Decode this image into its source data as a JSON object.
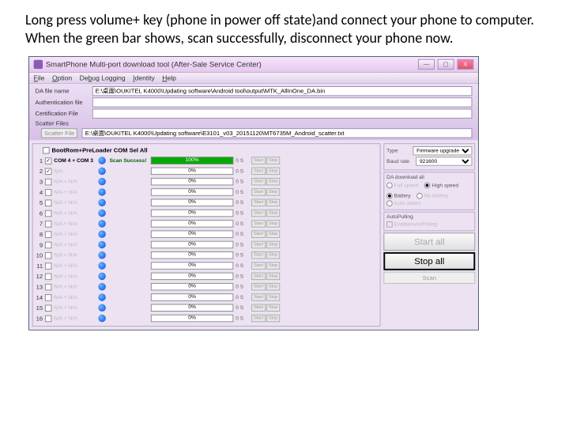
{
  "instruction": "Long press volume+ key (phone in power off state)and connect your phone to computer. When the green bar shows, scan successfully, disconnect your phone now.",
  "window": {
    "title": "SmartPhone Multi-port download tool (After-Sale Service Center)",
    "min": "—",
    "max": "▢",
    "close": "X"
  },
  "menu": [
    "File",
    "Option",
    "Debug Logging",
    "Identity",
    "Help"
  ],
  "files": {
    "da_label": "DA file name",
    "da_value": "E:\\桌面\\OUKITEL K4000\\Updating software\\Android tool\\output\\MTK_AllInOne_DA.bin",
    "auth_label": "Authentication file",
    "cert_label": "Certification File",
    "scatter_label": "Scatter Files",
    "scatter_btn": "Scatter File",
    "scatter_value": "E:\\桌面\\OUKITEL K4000\\Updating software\\E3101_v03_20151120\\MT6735M_Android_scatter.txt"
  },
  "selall_label": "BootRom+PreLoader COM Sel All",
  "rows": [
    {
      "idx": "1",
      "checked": true,
      "label": "COM 4 + COM 3",
      "active": true,
      "scan": "Scan Success!",
      "pct": "100%",
      "full": true,
      "size": "0 S"
    },
    {
      "idx": "2",
      "checked": true,
      "label": "N/A",
      "pct": "0%",
      "size": "0 S"
    },
    {
      "idx": "3",
      "label": "N/A + N/A",
      "pct": "0%",
      "size": "0 S"
    },
    {
      "idx": "4",
      "label": "N/A + N/A",
      "pct": "0%",
      "size": "0 S"
    },
    {
      "idx": "5",
      "label": "N/A + N/A",
      "pct": "0%",
      "size": "0 S"
    },
    {
      "idx": "6",
      "label": "N/A + N/A",
      "pct": "0%",
      "size": "0 S"
    },
    {
      "idx": "7",
      "label": "N/A + N/A",
      "pct": "0%",
      "size": "0 S"
    },
    {
      "idx": "8",
      "label": "N/A + N/A",
      "pct": "0%",
      "size": "0 S"
    },
    {
      "idx": "9",
      "label": "N/A + N/A",
      "pct": "0%",
      "size": "0 S"
    },
    {
      "idx": "10",
      "label": "N/A + N/A",
      "pct": "0%",
      "size": "0 S"
    },
    {
      "idx": "11",
      "label": "N/A + N/A",
      "pct": "0%",
      "size": "0 S"
    },
    {
      "idx": "12",
      "label": "N/A + N/A",
      "pct": "0%",
      "size": "0 S"
    },
    {
      "idx": "13",
      "label": "N/A + N/A",
      "pct": "0%",
      "size": "0 S"
    },
    {
      "idx": "14",
      "label": "N/A + N/A",
      "pct": "0%",
      "size": "0 S"
    },
    {
      "idx": "15",
      "label": "N/A + N/A",
      "pct": "0%",
      "size": "0 S"
    },
    {
      "idx": "16",
      "label": "N/A + N/A",
      "pct": "0%",
      "size": "0 S"
    }
  ],
  "row_btns": {
    "start": "Start",
    "stop": "Stop"
  },
  "right": {
    "type_label": "Type",
    "type_value": "Firmware upgrade",
    "baud_label": "Baud rate",
    "baud_value": "921600",
    "da_title": "DA download all",
    "full": "Full speed",
    "high": "High speed",
    "battery": "Battery",
    "nobat": "No battery",
    "auto": "Auto detect",
    "poll_title": "AutoPulling",
    "poll_chk": "EnableAutoPolling",
    "start_all": "Start all",
    "stop_all": "Stop all",
    "scan": "Scan"
  }
}
